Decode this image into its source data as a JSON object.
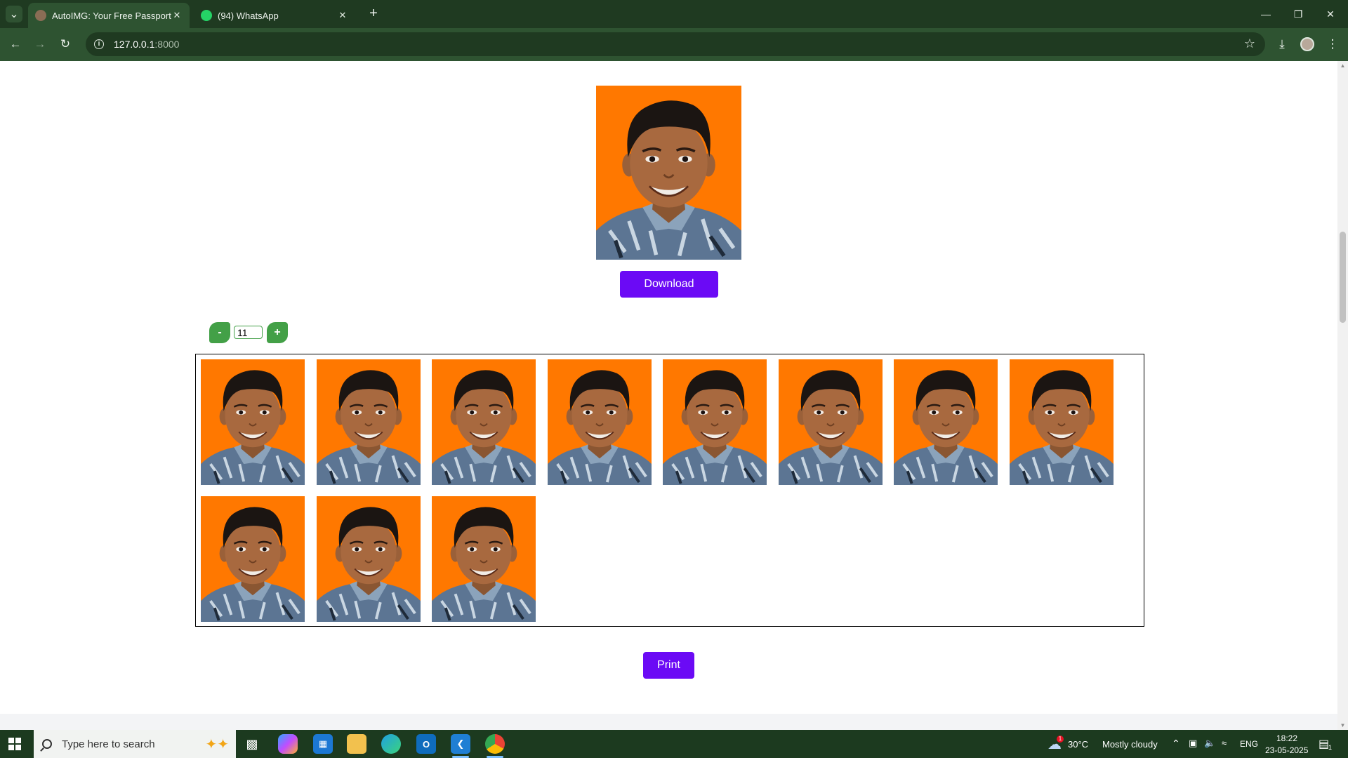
{
  "browser": {
    "tabs": [
      {
        "title": "AutoIMG: Your Free Passport to",
        "favicon_color": "#8a6d55",
        "active": true
      },
      {
        "title": "(94) WhatsApp",
        "favicon_color": "#25d366",
        "active": false
      }
    ],
    "url_host": "127.0.0.1",
    "url_port": ":8000"
  },
  "page": {
    "download_label": "Download",
    "quantity": {
      "minus_label": "-",
      "plus_label": "+",
      "value": "11"
    },
    "photo_count": 11,
    "print_label": "Print",
    "photo_background": "#ff7800",
    "button_color": "#6b0af5",
    "stepper_color": "#43a047"
  },
  "taskbar": {
    "search_placeholder": "Type here to search",
    "weather": {
      "temp": "30°C",
      "condition": "Mostly cloudy",
      "alert_count": "1"
    },
    "language": "ENG",
    "time": "18:22",
    "date": "23-05-2025",
    "notification_count": "1"
  }
}
